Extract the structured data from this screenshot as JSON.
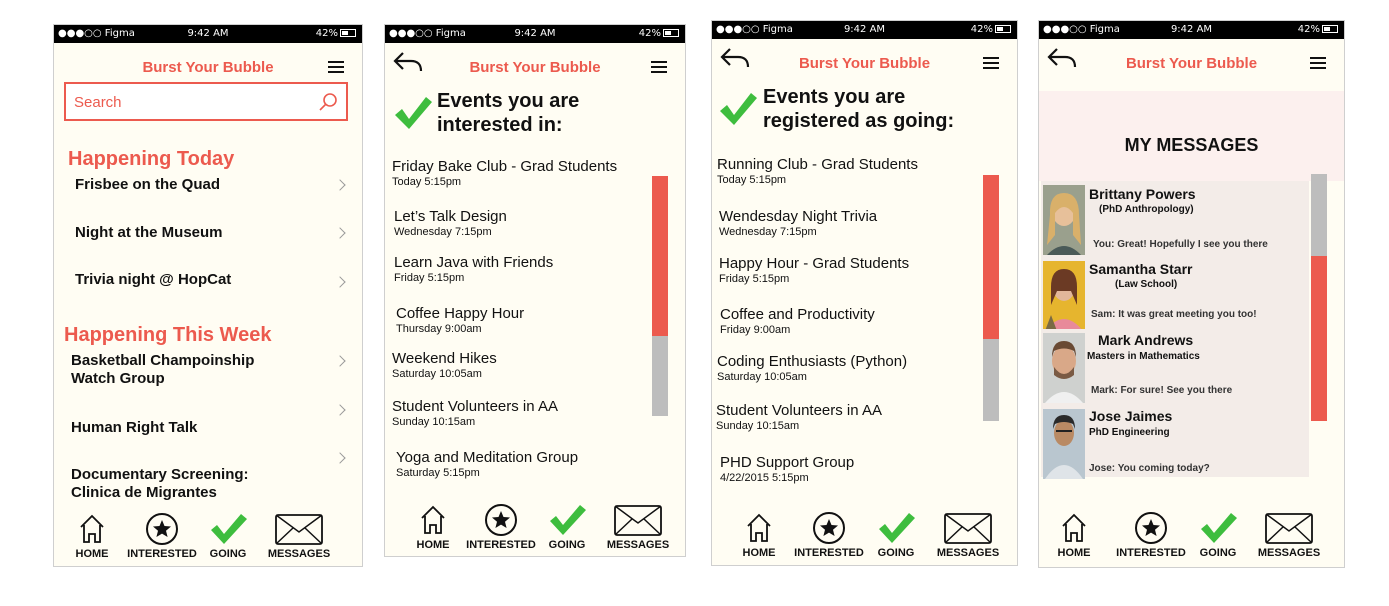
{
  "status": {
    "carrier": "●●●○○ Figma",
    "time": "9:42 AM",
    "battery": "42%"
  },
  "app_title": "Burst Your Bubble",
  "nav": {
    "home": "HOME",
    "interested": "INTERESTED",
    "going": "GOING",
    "messages": "MESSAGES"
  },
  "screen1": {
    "search_placeholder": "Search",
    "today_heading": "Happening Today",
    "today": [
      "Frisbee on the Quad",
      "Night at the Museum",
      "Trivia night @ HopCat"
    ],
    "week_heading": "Happening This Week",
    "week": [
      "Basketball Champoinship\nWatch Group",
      "Human Right Talk",
      "Documentary Screening:\nClinica de Migrantes"
    ]
  },
  "screen2": {
    "title_line1": "Events you are",
    "title_line2": "interested in:",
    "events": [
      {
        "name": "Friday Bake Club - Grad Students",
        "time": "Today 5:15pm"
      },
      {
        "name": "Let’s Talk Design",
        "time": "Wednesday 7:15pm"
      },
      {
        "name": "Learn Java with Friends",
        "time": "Friday 5:15pm"
      },
      {
        "name": "Coffee Happy Hour",
        "time": "Thursday 9:00am"
      },
      {
        "name": "Weekend Hikes",
        "time": "Saturday 10:05am"
      },
      {
        "name": "Student Volunteers in AA",
        "time": "Sunday 10:15am"
      },
      {
        "name": "Yoga and Meditation Group",
        "time": "Saturday 5:15pm"
      }
    ]
  },
  "screen3": {
    "title_line1": "Events you are",
    "title_line2": "registered as going:",
    "events": [
      {
        "name": "Running Club - Grad Students",
        "time": "Today 5:15pm"
      },
      {
        "name": "Wendesday Night Trivia",
        "time": "Wednesday 7:15pm"
      },
      {
        "name": "Happy Hour - Grad Students",
        "time": "Friday 5:15pm"
      },
      {
        "name": "Coffee and Productivity",
        "time": "Friday 9:00am"
      },
      {
        "name": "Coding Enthusiasts (Python)",
        "time": "Saturday 10:05am"
      },
      {
        "name": "Student Volunteers in AA",
        "time": "Sunday 10:15am"
      },
      {
        "name": "PHD Support Group",
        "time": "4/22/2015 5:15pm"
      }
    ]
  },
  "screen4": {
    "heading": "MY MESSAGES",
    "messages": [
      {
        "name": "Brittany Powers",
        "degree": "(PhD Anthropology)",
        "preview": "You: Great! Hopefully I see you there"
      },
      {
        "name": "Samantha Starr",
        "degree": "(Law School)",
        "preview": "Sam: It was great meeting you too!"
      },
      {
        "name": "Mark Andrews",
        "degree": "Masters in Mathematics",
        "preview": "Mark: For sure! See you there"
      },
      {
        "name": "Jose Jaimes",
        "degree": "PhD Engineering",
        "preview": "Jose: You coming today?"
      }
    ]
  },
  "colors": {
    "accent": "#ec5a4e",
    "check": "#3ebd3e",
    "scroll_grey": "#bdbdbd",
    "background": "#fffdf3"
  }
}
